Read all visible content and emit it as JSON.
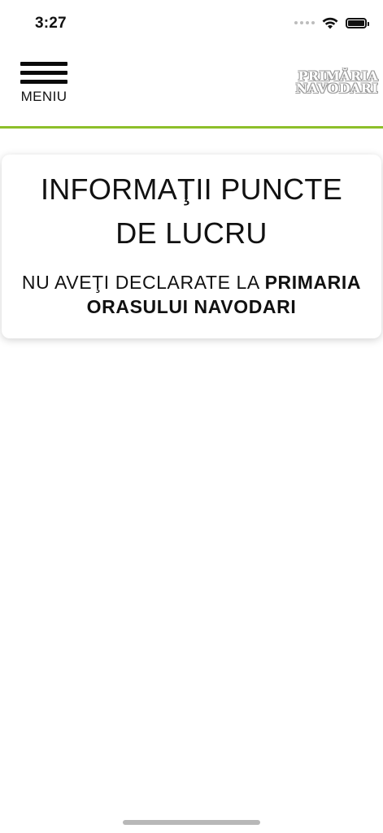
{
  "status_bar": {
    "time": "3:27",
    "icons": [
      "signal-dots-icon",
      "wifi-icon",
      "battery-icon"
    ]
  },
  "header": {
    "menu_label": "MENIU",
    "logo_line1": "PRIMĂRIA",
    "logo_line2": "NAVODARI",
    "accent_color": "#8dbf2a"
  },
  "card": {
    "title": "INFORMAŢII PUNCTE DE LUCRU",
    "message_prefix": "NU AVEŢI DECLARATE LA ",
    "message_bold": "PRIMARIA ORASULUI NAVODARI"
  }
}
